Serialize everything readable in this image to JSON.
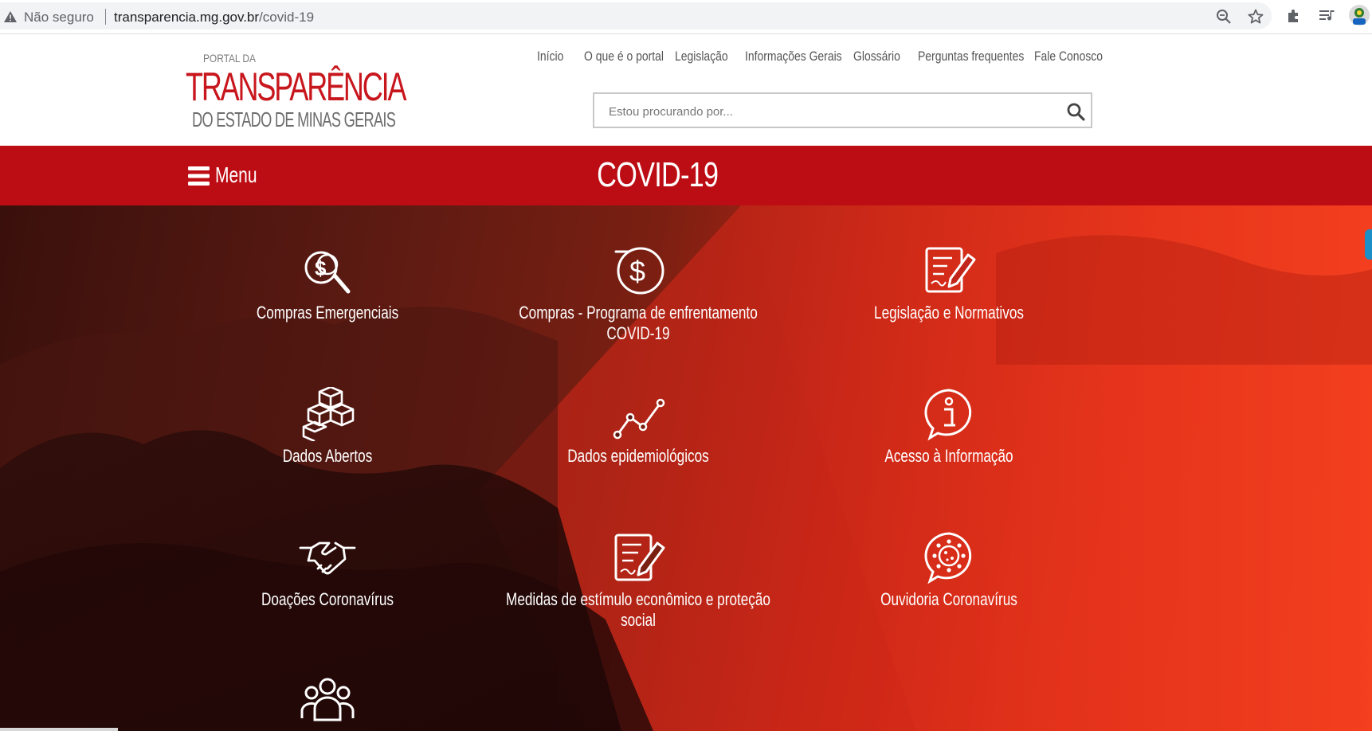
{
  "browser": {
    "security_label": "Não seguro",
    "url_host": "transparencia.mg.gov.br",
    "url_path": "/covid-19",
    "icons": [
      "warning-icon",
      "zoom-icon",
      "star-icon",
      "extensions-icon",
      "media-queue-icon",
      "profile-avatar"
    ]
  },
  "logo": {
    "top": "PORTAL DA",
    "main": "TRANSPARÊNCIA",
    "sub": "DO ESTADO DE MINAS GERAIS"
  },
  "nav": {
    "items": [
      "Início",
      "O que é o portal",
      "Legislação",
      "Informações Gerais",
      "Glossário",
      "Perguntas frequentes",
      "Fale Conosco"
    ]
  },
  "search": {
    "placeholder": "Estou procurando por...",
    "icon": "search-icon"
  },
  "band": {
    "menu_label": "Menu",
    "title": "COVID-19"
  },
  "tiles": [
    {
      "label": "Compras Emergenciais",
      "icon": "money-search-icon"
    },
    {
      "label": "Compras - Programa de enfrentamento COVID-19",
      "icon": "dollar-coin-icon"
    },
    {
      "label": "Legislação e Normativos",
      "icon": "document-edit-icon"
    },
    {
      "label": "Dados Abertos",
      "icon": "cubes-icon"
    },
    {
      "label": "Dados epidemiológicos",
      "icon": "line-chart-icon"
    },
    {
      "label": "Acesso à Informação",
      "icon": "info-bubble-icon"
    },
    {
      "label": "Doações Coronavírus",
      "icon": "handshake-icon"
    },
    {
      "label": "Medidas de estímulo econômico e proteção social",
      "icon": "document-pen-icon"
    },
    {
      "label": "Ouvidoria Coronavírus",
      "icon": "virus-bubble-icon"
    },
    {
      "label": "",
      "icon": "people-group-icon"
    }
  ],
  "colors": {
    "brand_red": "#bd0d14",
    "logo_red": "#c8161d",
    "hero_orange": "#f03a1c"
  }
}
